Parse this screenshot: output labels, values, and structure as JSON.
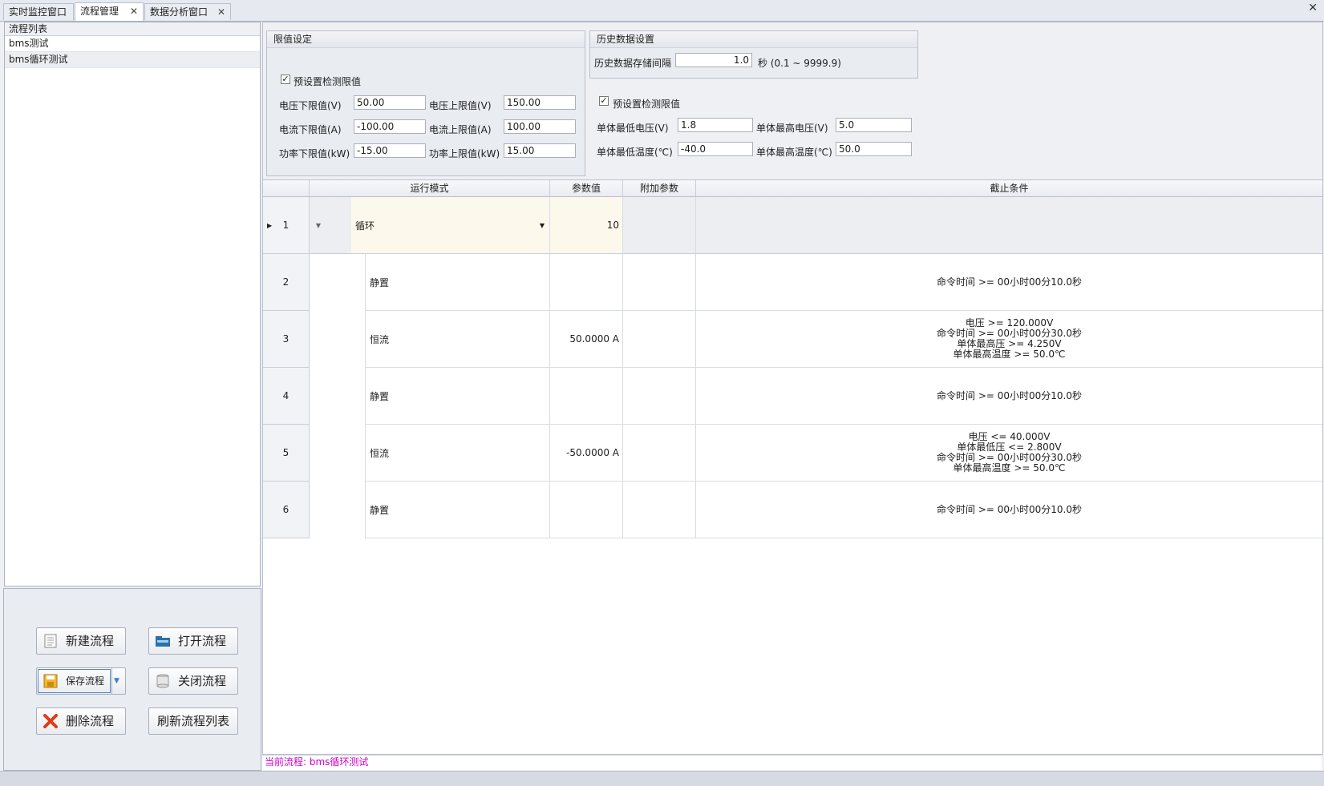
{
  "tabs": [
    {
      "label": "实时监控窗口",
      "closable": false
    },
    {
      "label": "流程管理",
      "closable": true
    },
    {
      "label": "数据分析窗口",
      "closable": true
    }
  ],
  "window_close": "✕",
  "left": {
    "header": "流程列表",
    "items": [
      "bms测试",
      "bms循环测试"
    ]
  },
  "buttons": {
    "new": "新建流程",
    "open": "打开流程",
    "save": "保存流程",
    "close": "关闭流程",
    "delete": "删除流程",
    "refresh": "刷新流程列表"
  },
  "limits": {
    "title": "限值设定",
    "preset_label": "预设置检测限值",
    "preset_checked": true,
    "v_low_label": "电压下限值(V)",
    "v_low": "50.00",
    "v_high_label": "电压上限值(V)",
    "v_high": "150.00",
    "i_low_label": "电流下限值(A)",
    "i_low": "-100.00",
    "i_high_label": "电流上限值(A)",
    "i_high": "100.00",
    "p_low_label": "功率下限值(kW)",
    "p_low": "-15.00",
    "p_high_label": "功率上限值(kW)",
    "p_high": "15.00"
  },
  "history": {
    "title": "历史数据设置",
    "interval_label": "历史数据存储间隔",
    "interval_value": "1.0",
    "interval_unit": "秒 (0.1 ~ 9999.9)"
  },
  "cell_limits": {
    "preset_label": "预设置检测限值",
    "preset_checked": true,
    "min_v_label": "单体最低电压(V)",
    "min_v": "1.8",
    "max_v_label": "单体最高电压(V)",
    "max_v": "5.0",
    "min_t_label": "单体最低温度(℃)",
    "min_t": "-40.0",
    "max_t_label": "单体最高温度(℃)",
    "max_t": "50.0"
  },
  "grid": {
    "columns": [
      "运行模式",
      "参数值",
      "附加参数",
      "截止条件"
    ],
    "rows": [
      {
        "num": "1",
        "mode": "循环",
        "param": "10",
        "extra": "",
        "cond": []
      },
      {
        "num": "2",
        "mode": "静置",
        "param": "",
        "extra": "",
        "cond": [
          "命令时间 >= 00小时00分10.0秒"
        ]
      },
      {
        "num": "3",
        "mode": "恒流",
        "param": "50.0000 A",
        "extra": "",
        "cond": [
          "电压 >= 120.000V",
          "命令时间 >= 00小时00分30.0秒",
          "单体最高压 >= 4.250V",
          "单体最高温度 >= 50.0℃"
        ]
      },
      {
        "num": "4",
        "mode": "静置",
        "param": "",
        "extra": "",
        "cond": [
          "命令时间 >= 00小时00分10.0秒"
        ]
      },
      {
        "num": "5",
        "mode": "恒流",
        "param": "-50.0000 A",
        "extra": "",
        "cond": [
          "电压 <= 40.000V",
          "单体最低压 <= 2.800V",
          "命令时间 >= 00小时00分30.0秒",
          "单体最高温度 >= 50.0℃"
        ]
      },
      {
        "num": "6",
        "mode": "静置",
        "param": "",
        "extra": "",
        "cond": [
          "命令时间 >= 00小时00分10.0秒"
        ]
      }
    ]
  },
  "status": {
    "current_label": "当前流程:",
    "current_value": "bms循环测试"
  },
  "colors": {
    "selected_row": "#fdf8ec",
    "status_text": "#d000c8",
    "accent": "#3a7bd5"
  }
}
